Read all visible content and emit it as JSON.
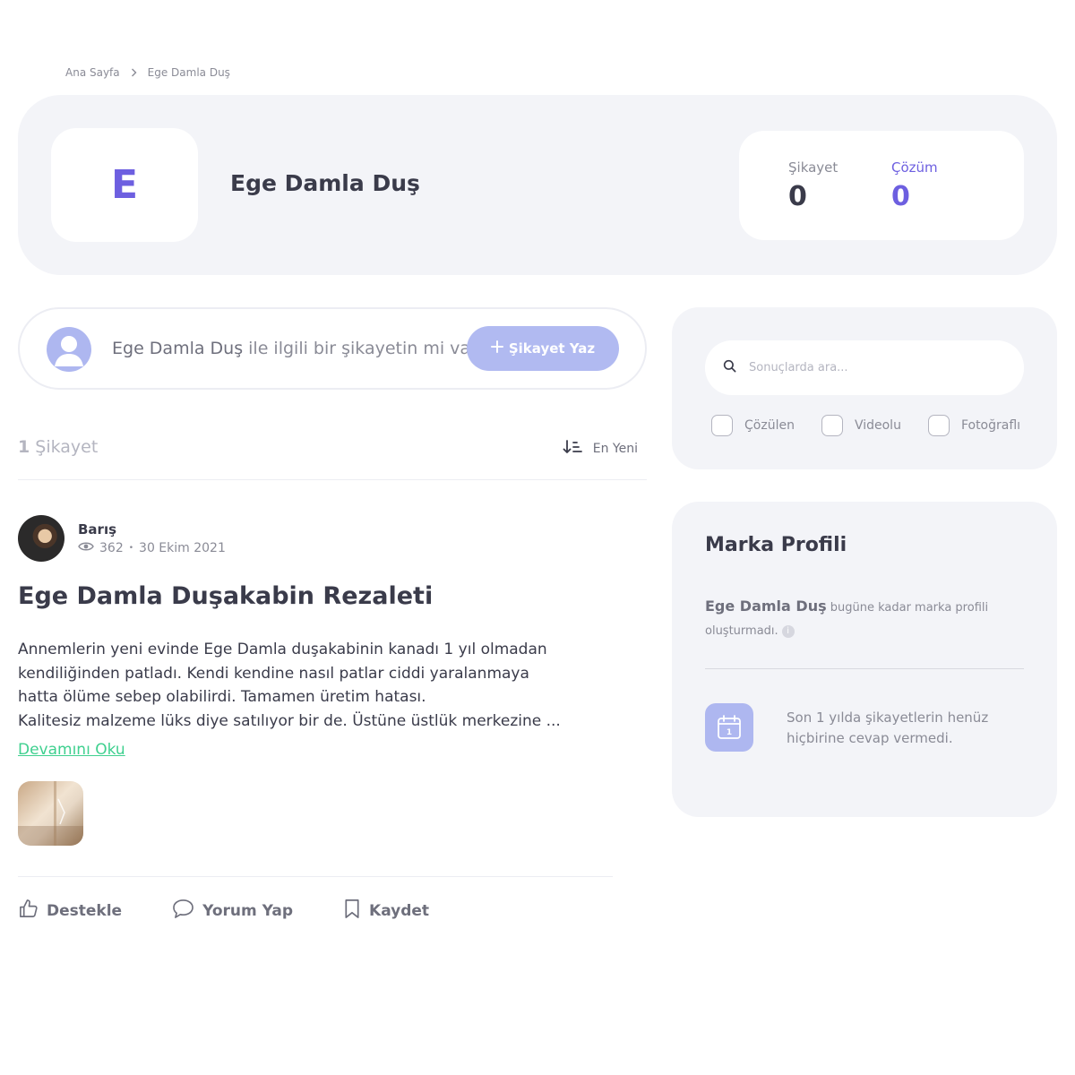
{
  "breadcrumb": {
    "home": "Ana Sayfa",
    "current": "Ege Damla Duş"
  },
  "brand": {
    "logo_letter": "E",
    "name": "Ege Damla Duş"
  },
  "stats": {
    "complaint_label": "Şikayet",
    "complaint_value": "0",
    "solution_label": "Çözüm",
    "solution_value": "0"
  },
  "write": {
    "brand": "Ege Damla Duş",
    "question": " ile ilgili bir şikayetin mi var?",
    "button_label": "Şikayet Yaz"
  },
  "list": {
    "count": "1",
    "count_label": " Şikayet",
    "sort_label": "En Yeni"
  },
  "post": {
    "author": "Barış",
    "views": "362",
    "dot": "•",
    "date": "30 Ekim 2021",
    "title": "Ege Damla Duşakabin Rezaleti",
    "body_lines": [
      "Annemlerin yeni evinde Ege Damla duşakabinin kanadı 1 yıl olmadan",
      "kendiliğinden patladı. Kendi kendine nasıl patlar ciddi yaralanmaya",
      "hatta ölüme sebep olabilirdi. Tamamen üretim hatası.",
      "Kalitesiz malzeme lüks diye satılıyor bir de. Üstüne üstlük merkezine ..."
    ],
    "read_more": "Devamını Oku",
    "actions": {
      "support": "Destekle",
      "comment": "Yorum Yap",
      "save": "Kaydet"
    }
  },
  "search": {
    "placeholder": "Sonuçlarda ara...",
    "filters": [
      "Çözülen",
      "Videolu",
      "Fotoğraflı"
    ]
  },
  "profile": {
    "title": "Marka Profili",
    "brand": "Ege Damla Duş",
    "note": " bugüne kadar marka profili oluşturmadı.",
    "info": "i",
    "calendar_day": "1",
    "response_text": "Son 1 yılda şikayetlerin henüz hiçbirine cevap vermedi."
  },
  "colors": {
    "accent": "#6d5fe0",
    "button": "#b1baf1",
    "link": "#3fd08f",
    "card": "#f3f4f8"
  }
}
